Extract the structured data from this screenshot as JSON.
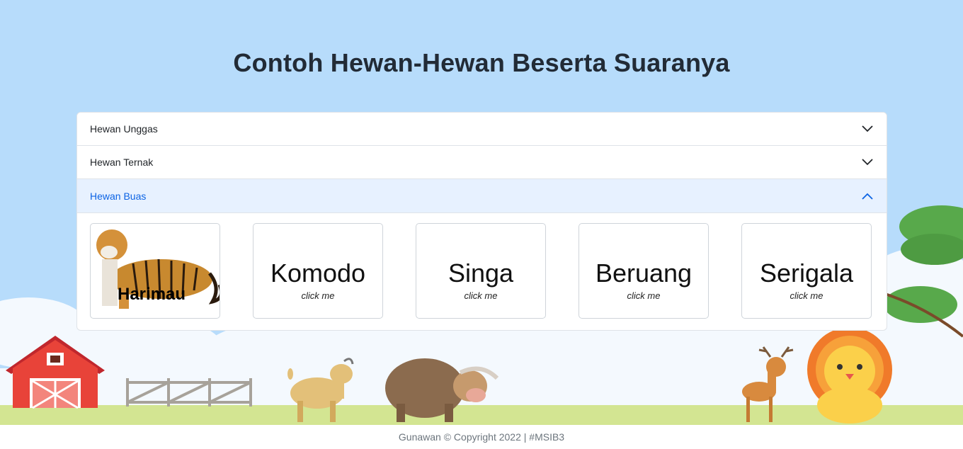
{
  "page": {
    "title": "Contoh Hewan-Hewan Beserta Suaranya"
  },
  "accordion": {
    "items": [
      {
        "label": "Hewan Unggas",
        "expanded": false
      },
      {
        "label": "Hewan Ternak",
        "expanded": false
      },
      {
        "label": "Hewan Buas",
        "expanded": true
      }
    ],
    "cards": [
      {
        "label": "Harimau",
        "type": "image"
      },
      {
        "label": "Komodo",
        "sub": "click me"
      },
      {
        "label": "Singa",
        "sub": "click me"
      },
      {
        "label": "Beruang",
        "sub": "click me"
      },
      {
        "label": "Serigala",
        "sub": "click me"
      }
    ]
  },
  "footer": {
    "text": "Gunawan © Copyright 2022 | #MSIB3"
  },
  "colors": {
    "sky": "#b7dcfb",
    "grass": "#d3e592",
    "accent": "#0c63e4",
    "open_header_bg": "#e7f1ff"
  },
  "icons": [
    "chevron-down-icon",
    "chevron-up-icon"
  ]
}
